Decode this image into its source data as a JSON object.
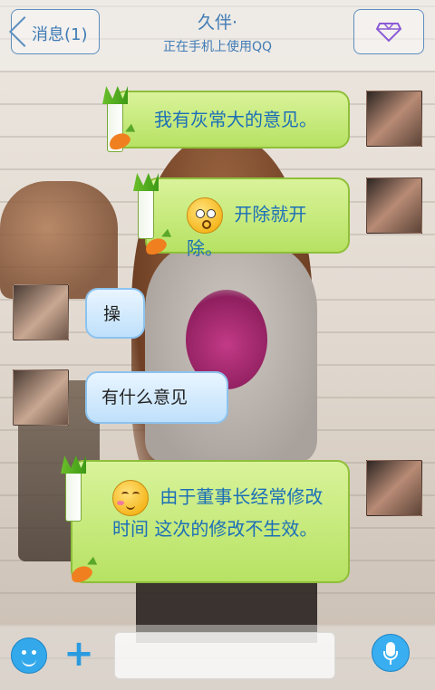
{
  "header": {
    "back_label": "消息(1)",
    "contact_name": "久伴·",
    "status": "正在手机上使用QQ",
    "gem_icon": "diamond-icon"
  },
  "messages": [
    {
      "sender": "me",
      "text": "我有灰常大的意见。"
    },
    {
      "sender": "me",
      "emoji": "surprised-smiley",
      "text": "开除就开除。"
    },
    {
      "sender": "other",
      "text": "操"
    },
    {
      "sender": "other",
      "text": "有什么意见"
    },
    {
      "sender": "me",
      "emoji": "sleepy-smiley",
      "text": "由于董事长经常修改时间 这次的修改不生效。"
    }
  ],
  "input": {
    "placeholder": "",
    "value": ""
  },
  "colors": {
    "accent": "#3f7bb5",
    "bubble_green": "#b7e263",
    "bubble_blue": "#bfe0fb",
    "button_blue": "#33a9ec"
  }
}
